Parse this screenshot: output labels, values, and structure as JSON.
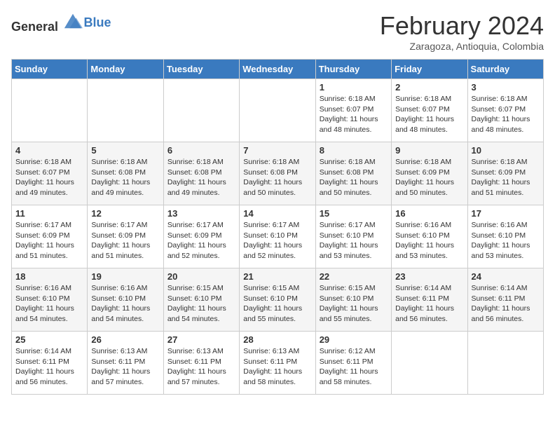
{
  "logo": {
    "text_general": "General",
    "text_blue": "Blue"
  },
  "header": {
    "month_year": "February 2024",
    "location": "Zaragoza, Antioquia, Colombia"
  },
  "columns": [
    "Sunday",
    "Monday",
    "Tuesday",
    "Wednesday",
    "Thursday",
    "Friday",
    "Saturday"
  ],
  "weeks": [
    [
      {
        "day": "",
        "info": ""
      },
      {
        "day": "",
        "info": ""
      },
      {
        "day": "",
        "info": ""
      },
      {
        "day": "",
        "info": ""
      },
      {
        "day": "1",
        "info": "Sunrise: 6:18 AM\nSunset: 6:07 PM\nDaylight: 11 hours and 48 minutes."
      },
      {
        "day": "2",
        "info": "Sunrise: 6:18 AM\nSunset: 6:07 PM\nDaylight: 11 hours and 48 minutes."
      },
      {
        "day": "3",
        "info": "Sunrise: 6:18 AM\nSunset: 6:07 PM\nDaylight: 11 hours and 48 minutes."
      }
    ],
    [
      {
        "day": "4",
        "info": "Sunrise: 6:18 AM\nSunset: 6:07 PM\nDaylight: 11 hours and 49 minutes."
      },
      {
        "day": "5",
        "info": "Sunrise: 6:18 AM\nSunset: 6:08 PM\nDaylight: 11 hours and 49 minutes."
      },
      {
        "day": "6",
        "info": "Sunrise: 6:18 AM\nSunset: 6:08 PM\nDaylight: 11 hours and 49 minutes."
      },
      {
        "day": "7",
        "info": "Sunrise: 6:18 AM\nSunset: 6:08 PM\nDaylight: 11 hours and 50 minutes."
      },
      {
        "day": "8",
        "info": "Sunrise: 6:18 AM\nSunset: 6:08 PM\nDaylight: 11 hours and 50 minutes."
      },
      {
        "day": "9",
        "info": "Sunrise: 6:18 AM\nSunset: 6:09 PM\nDaylight: 11 hours and 50 minutes."
      },
      {
        "day": "10",
        "info": "Sunrise: 6:18 AM\nSunset: 6:09 PM\nDaylight: 11 hours and 51 minutes."
      }
    ],
    [
      {
        "day": "11",
        "info": "Sunrise: 6:17 AM\nSunset: 6:09 PM\nDaylight: 11 hours and 51 minutes."
      },
      {
        "day": "12",
        "info": "Sunrise: 6:17 AM\nSunset: 6:09 PM\nDaylight: 11 hours and 51 minutes."
      },
      {
        "day": "13",
        "info": "Sunrise: 6:17 AM\nSunset: 6:09 PM\nDaylight: 11 hours and 52 minutes."
      },
      {
        "day": "14",
        "info": "Sunrise: 6:17 AM\nSunset: 6:10 PM\nDaylight: 11 hours and 52 minutes."
      },
      {
        "day": "15",
        "info": "Sunrise: 6:17 AM\nSunset: 6:10 PM\nDaylight: 11 hours and 53 minutes."
      },
      {
        "day": "16",
        "info": "Sunrise: 6:16 AM\nSunset: 6:10 PM\nDaylight: 11 hours and 53 minutes."
      },
      {
        "day": "17",
        "info": "Sunrise: 6:16 AM\nSunset: 6:10 PM\nDaylight: 11 hours and 53 minutes."
      }
    ],
    [
      {
        "day": "18",
        "info": "Sunrise: 6:16 AM\nSunset: 6:10 PM\nDaylight: 11 hours and 54 minutes."
      },
      {
        "day": "19",
        "info": "Sunrise: 6:16 AM\nSunset: 6:10 PM\nDaylight: 11 hours and 54 minutes."
      },
      {
        "day": "20",
        "info": "Sunrise: 6:15 AM\nSunset: 6:10 PM\nDaylight: 11 hours and 54 minutes."
      },
      {
        "day": "21",
        "info": "Sunrise: 6:15 AM\nSunset: 6:10 PM\nDaylight: 11 hours and 55 minutes."
      },
      {
        "day": "22",
        "info": "Sunrise: 6:15 AM\nSunset: 6:10 PM\nDaylight: 11 hours and 55 minutes."
      },
      {
        "day": "23",
        "info": "Sunrise: 6:14 AM\nSunset: 6:11 PM\nDaylight: 11 hours and 56 minutes."
      },
      {
        "day": "24",
        "info": "Sunrise: 6:14 AM\nSunset: 6:11 PM\nDaylight: 11 hours and 56 minutes."
      }
    ],
    [
      {
        "day": "25",
        "info": "Sunrise: 6:14 AM\nSunset: 6:11 PM\nDaylight: 11 hours and 56 minutes."
      },
      {
        "day": "26",
        "info": "Sunrise: 6:13 AM\nSunset: 6:11 PM\nDaylight: 11 hours and 57 minutes."
      },
      {
        "day": "27",
        "info": "Sunrise: 6:13 AM\nSunset: 6:11 PM\nDaylight: 11 hours and 57 minutes."
      },
      {
        "day": "28",
        "info": "Sunrise: 6:13 AM\nSunset: 6:11 PM\nDaylight: 11 hours and 58 minutes."
      },
      {
        "day": "29",
        "info": "Sunrise: 6:12 AM\nSunset: 6:11 PM\nDaylight: 11 hours and 58 minutes."
      },
      {
        "day": "",
        "info": ""
      },
      {
        "day": "",
        "info": ""
      }
    ]
  ]
}
